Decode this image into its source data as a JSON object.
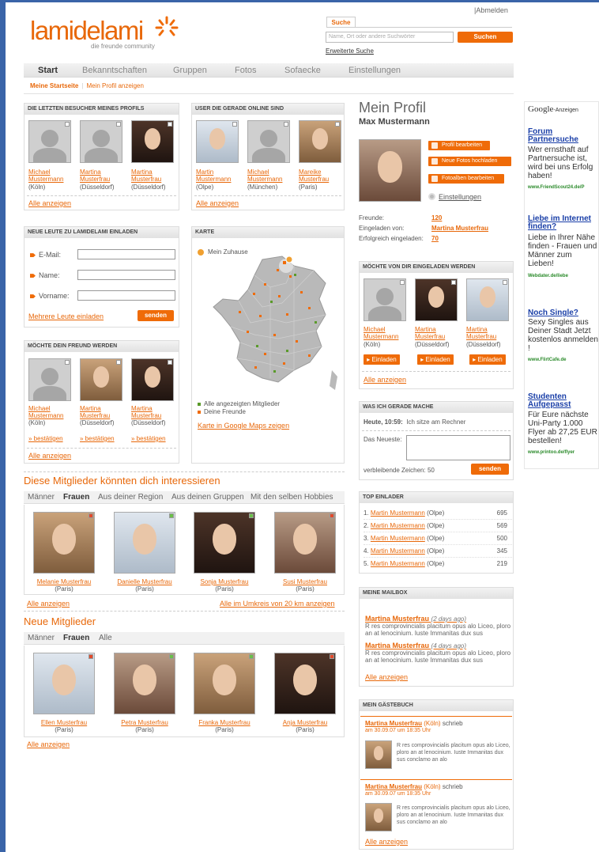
{
  "header": {
    "logo_part1": "lami",
    "logo_part2": "delami",
    "tagline": "die freunde community",
    "logout": "|Abmelden",
    "search_tab": "Suche",
    "search_placeholder": "Name, Ort oder andere Suchwörter",
    "search_button": "Suchen",
    "advanced_search": "Erweiterte Suche"
  },
  "nav": {
    "items": [
      "Start",
      "Bekanntschaften",
      "Gruppen",
      "Fotos",
      "Sofaecke",
      "Einstellungen"
    ]
  },
  "subnav": {
    "active": "Meine Startseite",
    "other": "Mein Profil anzeigen"
  },
  "visitors": {
    "title": "Die letzten Besucher meines Profils",
    "people": [
      {
        "first": "Michael",
        "last": "Mustermann",
        "city": "(Köln)"
      },
      {
        "first": "Martina",
        "last": "Musterfrau",
        "city": "(Düsseldorf)"
      },
      {
        "first": "Martina",
        "last": "Musterfrau",
        "city": "(Düsseldorf)"
      }
    ],
    "all": "Alle anzeigen"
  },
  "online": {
    "title": "User die gerade online sind",
    "people": [
      {
        "first": "Martin",
        "last": "Mustermann",
        "city": "(Olpe)"
      },
      {
        "first": "Michael",
        "last": "Mustermann",
        "city": "(München)"
      },
      {
        "first": "Mareike",
        "last": "Musterfrau",
        "city": "(Paris)"
      }
    ],
    "all": "Alle anzeigen"
  },
  "invite": {
    "title": "Neue Leute zu lamidelami einladen",
    "email": "E-Mail:",
    "name": "Name:",
    "firstname": "Vorname:",
    "multi": "Mehrere Leute einladen",
    "send": "senden"
  },
  "map": {
    "title": "Karte",
    "home": "Mein Zuhause",
    "legend_members": "Alle angezeigten Mitglieder",
    "legend_friends": "Deine Freunde",
    "google_link": "Karte in Google Maps zeigen"
  },
  "friend_req": {
    "title": "Möchte dein Freund werden",
    "people": [
      {
        "first": "Michael",
        "last": "Mustermann",
        "city": "(Köln)"
      },
      {
        "first": "Martina",
        "last": "Musterfrau",
        "city": "(Düsseldorf)"
      },
      {
        "first": "Martina",
        "last": "Musterfrau",
        "city": "(Düsseldorf)"
      }
    ],
    "confirm": "» bestätigen",
    "all": "Alle anzeigen"
  },
  "interest": {
    "title": "Diese Mitglieder könnten dich interessieren",
    "tabs": [
      "Männer",
      "Frauen",
      "Aus deiner Region",
      "Aus deinen Gruppen",
      "Mit den selben Hobbies"
    ],
    "people": [
      {
        "name": "Melanie Musterfrau",
        "city": "(Paris)"
      },
      {
        "name": "Danielle Musterfrau",
        "city": "(Paris)"
      },
      {
        "name": "Sonja Musterfrau",
        "city": "(Paris)"
      },
      {
        "name": "Susi Musterfrau",
        "city": "(Paris)"
      }
    ],
    "all": "Alle anzeigen",
    "radius": "Alle im Umkreis von 20 km anzeigen"
  },
  "newmembers": {
    "title": "Neue Mitglieder",
    "tabs": [
      "Männer",
      "Frauen",
      "Alle"
    ],
    "people": [
      {
        "name": "Ellen Musterfrau",
        "city": "(Paris)"
      },
      {
        "name": "Petra Musterfrau",
        "city": "(Paris)"
      },
      {
        "name": "Franka Musterfrau",
        "city": "(Paris)"
      },
      {
        "name": "Anja Musterfrau",
        "city": "(Paris)"
      }
    ],
    "all": "Alle anzeigen"
  },
  "profile": {
    "title": "Mein Profil",
    "name": "Max Mustermann",
    "edit": "Profil bearbeiten",
    "upload": "Neue Fotos hochladen",
    "albums": "Fotoalben bearbeiten",
    "settings": "Einstellungen",
    "friends_label": "Freunde:",
    "friends_value": "120",
    "invited_by_label": "Eingeladen von:",
    "invited_by_value": "Martina Musterfrau",
    "invited_label": "Erfolgreich eingeladen:",
    "invited_value": "70"
  },
  "wants_invite": {
    "title": "Möchte von dir eingeladen werden",
    "people": [
      {
        "first": "Michael",
        "last": "Mustermann",
        "city": "(Köln)"
      },
      {
        "first": "Martina",
        "last": "Musterfrau",
        "city": "(Düsseldorf)"
      },
      {
        "first": "Martina",
        "last": "Musterfrau",
        "city": "(Düsseldorf)"
      }
    ],
    "button": "Einladen",
    "all": "Alle anzeigen"
  },
  "status": {
    "title": "Was ich gerade mache",
    "time": "Heute, 10:59:",
    "text": "Ich sitze am Rechner",
    "newest": "Das Neueste:",
    "remaining": "verbleibende Zeichen: 50",
    "send": "senden"
  },
  "top": {
    "title": "Top Einlader",
    "rows": [
      {
        "rank": "1.",
        "name": "Martin Mustermann",
        "city": "(Olpe)",
        "value": "695"
      },
      {
        "rank": "2.",
        "name": "Martin Mustermann",
        "city": "(Olpe)",
        "value": "569"
      },
      {
        "rank": "3.",
        "name": "Martin Mustermann",
        "city": "(Olpe)",
        "value": "500"
      },
      {
        "rank": "4.",
        "name": "Martin Mustermann",
        "city": "(Olpe)",
        "value": "345"
      },
      {
        "rank": "5.",
        "name": "Martin Mustermann",
        "city": "(Olpe)",
        "value": "219"
      }
    ]
  },
  "mailbox": {
    "title": "Meine Mailbox",
    "items": [
      {
        "from": "Martina Musterfrau",
        "date": "(2 days ago)",
        "text": "R res comprovincialis placitum opus alo Liceo, ploro an at lenocinium. Iuste Immanitas dux sus"
      },
      {
        "from": "Martina Musterfrau",
        "date": "(4 days ago)",
        "text": "R res comprovincialis placitum opus alo Liceo, ploro an at lenocinium. Iuste Immanitas dux sus"
      }
    ],
    "all": "Alle anzeigen"
  },
  "guestbook": {
    "title": "Mein Gästebuch",
    "items": [
      {
        "from": "Martina Musterfrau",
        "city": "(Köln)",
        "wrote": "schrieb",
        "date": "am 30.09.07 um 18:35 Uhr",
        "text": "R res comprovincialis placitum opus alo Liceo, ploro an at lenocinium. Iuste Immanitas dux sus conclamo an alo"
      },
      {
        "from": "Martina Musterfrau",
        "city": "(Köln)",
        "wrote": "schrieb",
        "date": "am 30.09.07 um 18:35 Uhr",
        "text": "R res comprovincialis placitum opus alo Liceo, ploro an at lenocinium. Iuste Immanitas dux sus conclamo an alo"
      }
    ],
    "all": "Alle anzeigen"
  },
  "ads": {
    "google_logo": "Google",
    "label": "-Anzeigen",
    "items": [
      {
        "title": "Forum Partnersuche",
        "body": "Wer ernsthaft auf Partnersuche ist, wird bei uns Erfolg haben!",
        "url": "www.FriendScout24.de/P"
      },
      {
        "title": "Liebe im Internet finden?",
        "body": "Liebe in Ihrer Nähe finden - Frauen und Männer zum Lieben!",
        "url": "Webdater.de/liebe"
      },
      {
        "title": "Noch Single?",
        "body": "Sexy Singles aus Deiner Stadt Jetzt kostenlos anmelden !",
        "url": "www.FlirtCafe.de"
      },
      {
        "title": "Studenten Aufgepasst",
        "body": "Für Eure nächste Uni-Party 1.000 Flyer ab 27,25 EUR bestellen!",
        "url": "www.printoo.de/flyer"
      }
    ]
  },
  "colors": {
    "accent": "#ef6b08",
    "frame": "#3a64a8",
    "ad_title": "#1a3fa8",
    "ad_url": "#2a8a2a"
  }
}
